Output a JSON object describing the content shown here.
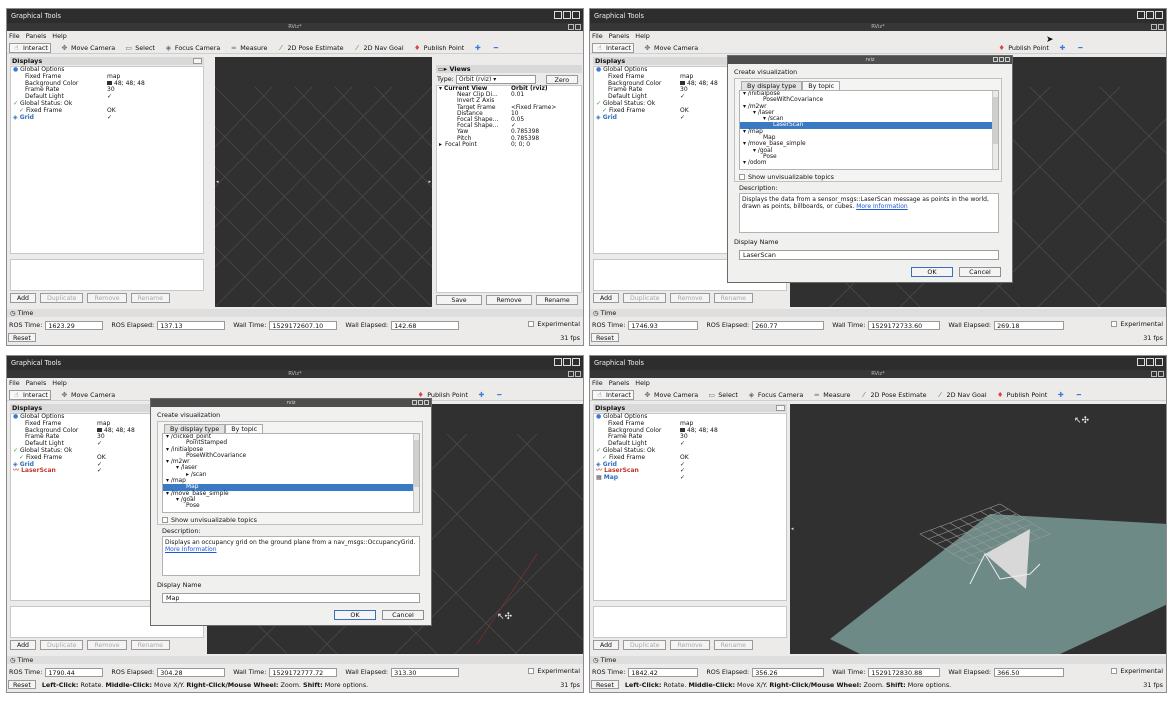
{
  "common": {
    "graphical_title": "Graphical Tools",
    "rviz_title": "RViz*",
    "menu": [
      "File",
      "Panels",
      "Help"
    ],
    "tools": {
      "interact": "Interact",
      "move_camera": "Move Camera",
      "select": "Select",
      "focus_camera": "Focus Camera",
      "measure": "Measure",
      "pose_estimate": "2D Pose Estimate",
      "nav_goal": "2D Nav Goal",
      "publish_point": "Publish Point"
    },
    "displays_title": "Displays",
    "display_buttons": [
      "Add",
      "Duplicate",
      "Remove",
      "Rename"
    ],
    "time_title": "Time",
    "labels": {
      "ros_time": "ROS Time:",
      "ros_elapsed": "ROS Elapsed:",
      "wall_time": "Wall Time:",
      "wall_elapsed": "Wall Elapsed:",
      "experimental": "Experimental"
    },
    "reset": "Reset",
    "fps": "31 fps",
    "hint": {
      "lc": "Left-Click:",
      "lc_d": " Rotate. ",
      "mc": "Middle-Click:",
      "mc_d": " Move X/Y. ",
      "rc": "Right-Click/Mouse Wheel:",
      "rc_d": " Zoom. ",
      "sh": "Shift:",
      "sh_d": " More options."
    },
    "tree": {
      "global_options": "Global Options",
      "fixed_frame": "Fixed Frame",
      "fixed_frame_val": "map",
      "bg_color": "Background Color",
      "bg_color_val": "48; 48; 48",
      "frame_rate": "Frame Rate",
      "frame_rate_val": "30",
      "default_light": "Default Light",
      "check": "✓",
      "global_status": "Global Status: Ok",
      "fixed_frame_status": "Fixed Frame",
      "ok": "OK",
      "grid": "Grid",
      "laserscan": "LaserScan",
      "map": "Map"
    }
  },
  "panel1": {
    "ros_time": "1623.29",
    "ros_elapsed": "137.13",
    "wall_time": "1529172607.10",
    "wall_elapsed": "142.68",
    "views": {
      "title": "Views",
      "type_label": "Type:",
      "type_value": "Orbit (rviz)",
      "zero": "Zero",
      "current_view": "Current View",
      "current_view_val": "Orbit (rviz)",
      "rows": [
        {
          "k": "Near Clip Di...",
          "v": "0.01"
        },
        {
          "k": "Invert Z Axis",
          "v": ""
        },
        {
          "k": "Target Frame",
          "v": "<Fixed Frame>"
        },
        {
          "k": "Distance",
          "v": "10"
        },
        {
          "k": "Focal Shape...",
          "v": "0.05"
        },
        {
          "k": "Focal Shape...",
          "v": "✓"
        },
        {
          "k": "Yaw",
          "v": "0.785398"
        },
        {
          "k": "Pitch",
          "v": "0.785398"
        },
        {
          "k": "Focal Point",
          "v": "0; 0; 0"
        }
      ],
      "buttons": [
        "Save",
        "Remove",
        "Rename"
      ]
    }
  },
  "panel2": {
    "ros_time": "1746.93",
    "ros_elapsed": "260.77",
    "wall_time": "1529172733.60",
    "wall_elapsed": "269.18",
    "dialog": {
      "title": "rviz",
      "heading": "Create visualization",
      "tab_type": "By display type",
      "tab_topic": "By topic",
      "list": [
        {
          "t": "▾ /initialpose",
          "lvl": 0
        },
        {
          "t": "PoseWithCovariance",
          "lvl": 2
        },
        {
          "t": "▾ /m2wr",
          "lvl": 0
        },
        {
          "t": "▾ /laser",
          "lvl": 1
        },
        {
          "t": "▾ /scan",
          "lvl": 2
        },
        {
          "t": "LaserScan",
          "lvl": 3,
          "hl": true
        },
        {
          "t": "▾ /map",
          "lvl": 0
        },
        {
          "t": "Map",
          "lvl": 2
        },
        {
          "t": "▾ /move_base_simple",
          "lvl": 0
        },
        {
          "t": "▾ /goal",
          "lvl": 1
        },
        {
          "t": "Pose",
          "lvl": 2
        },
        {
          "t": "▾ /odom",
          "lvl": 0
        }
      ],
      "show_unvis": "Show unvisualizable topics",
      "desc_label": "Description:",
      "desc": "Displays the data from a sensor_msgs::LaserScan message as points in the world, drawn as points, billboards, or cubes.",
      "more": "More Information",
      "name_label": "Display Name",
      "name_value": "LaserScan",
      "ok": "OK",
      "cancel": "Cancel"
    }
  },
  "panel3": {
    "ros_time": "1790.44",
    "ros_elapsed": "304.28",
    "wall_time": "1529172777.72",
    "wall_elapsed": "313.30",
    "dialog": {
      "title": "rviz",
      "heading": "Create visualization",
      "tab_type": "By display type",
      "tab_topic": "By topic",
      "list": [
        {
          "t": "▾ /clicked_point",
          "lvl": 0
        },
        {
          "t": "PointStamped",
          "lvl": 2
        },
        {
          "t": "▾ /initialpose",
          "lvl": 0
        },
        {
          "t": "PoseWithCovariance",
          "lvl": 2
        },
        {
          "t": "▾ /m2wr",
          "lvl": 0
        },
        {
          "t": "▾ /laser",
          "lvl": 1
        },
        {
          "t": "▸ /scan",
          "lvl": 2
        },
        {
          "t": "▾ /map",
          "lvl": 0
        },
        {
          "t": "Map",
          "lvl": 2,
          "hl": true
        },
        {
          "t": "▾ /move_base_simple",
          "lvl": 0
        },
        {
          "t": "▾ /goal",
          "lvl": 1
        },
        {
          "t": "Pose",
          "lvl": 2
        }
      ],
      "show_unvis": "Show unvisualizable topics",
      "desc_label": "Description:",
      "desc": "Displays an occupancy grid on the ground plane from a nav_msgs::OccupancyGrid.",
      "more": "More Information",
      "name_label": "Display Name",
      "name_value": "Map",
      "ok": "OK",
      "cancel": "Cancel"
    }
  },
  "panel4": {
    "ros_time": "1842.42",
    "ros_elapsed": "356.26",
    "wall_time": "1529172830.88",
    "wall_elapsed": "366.50"
  },
  "colors": {
    "viewport_bg": "#303030",
    "grid_line": "#4a4a4a",
    "map_plane": "#6e8a86",
    "selection": "#3a7ac4",
    "link": "#1a56d6"
  }
}
